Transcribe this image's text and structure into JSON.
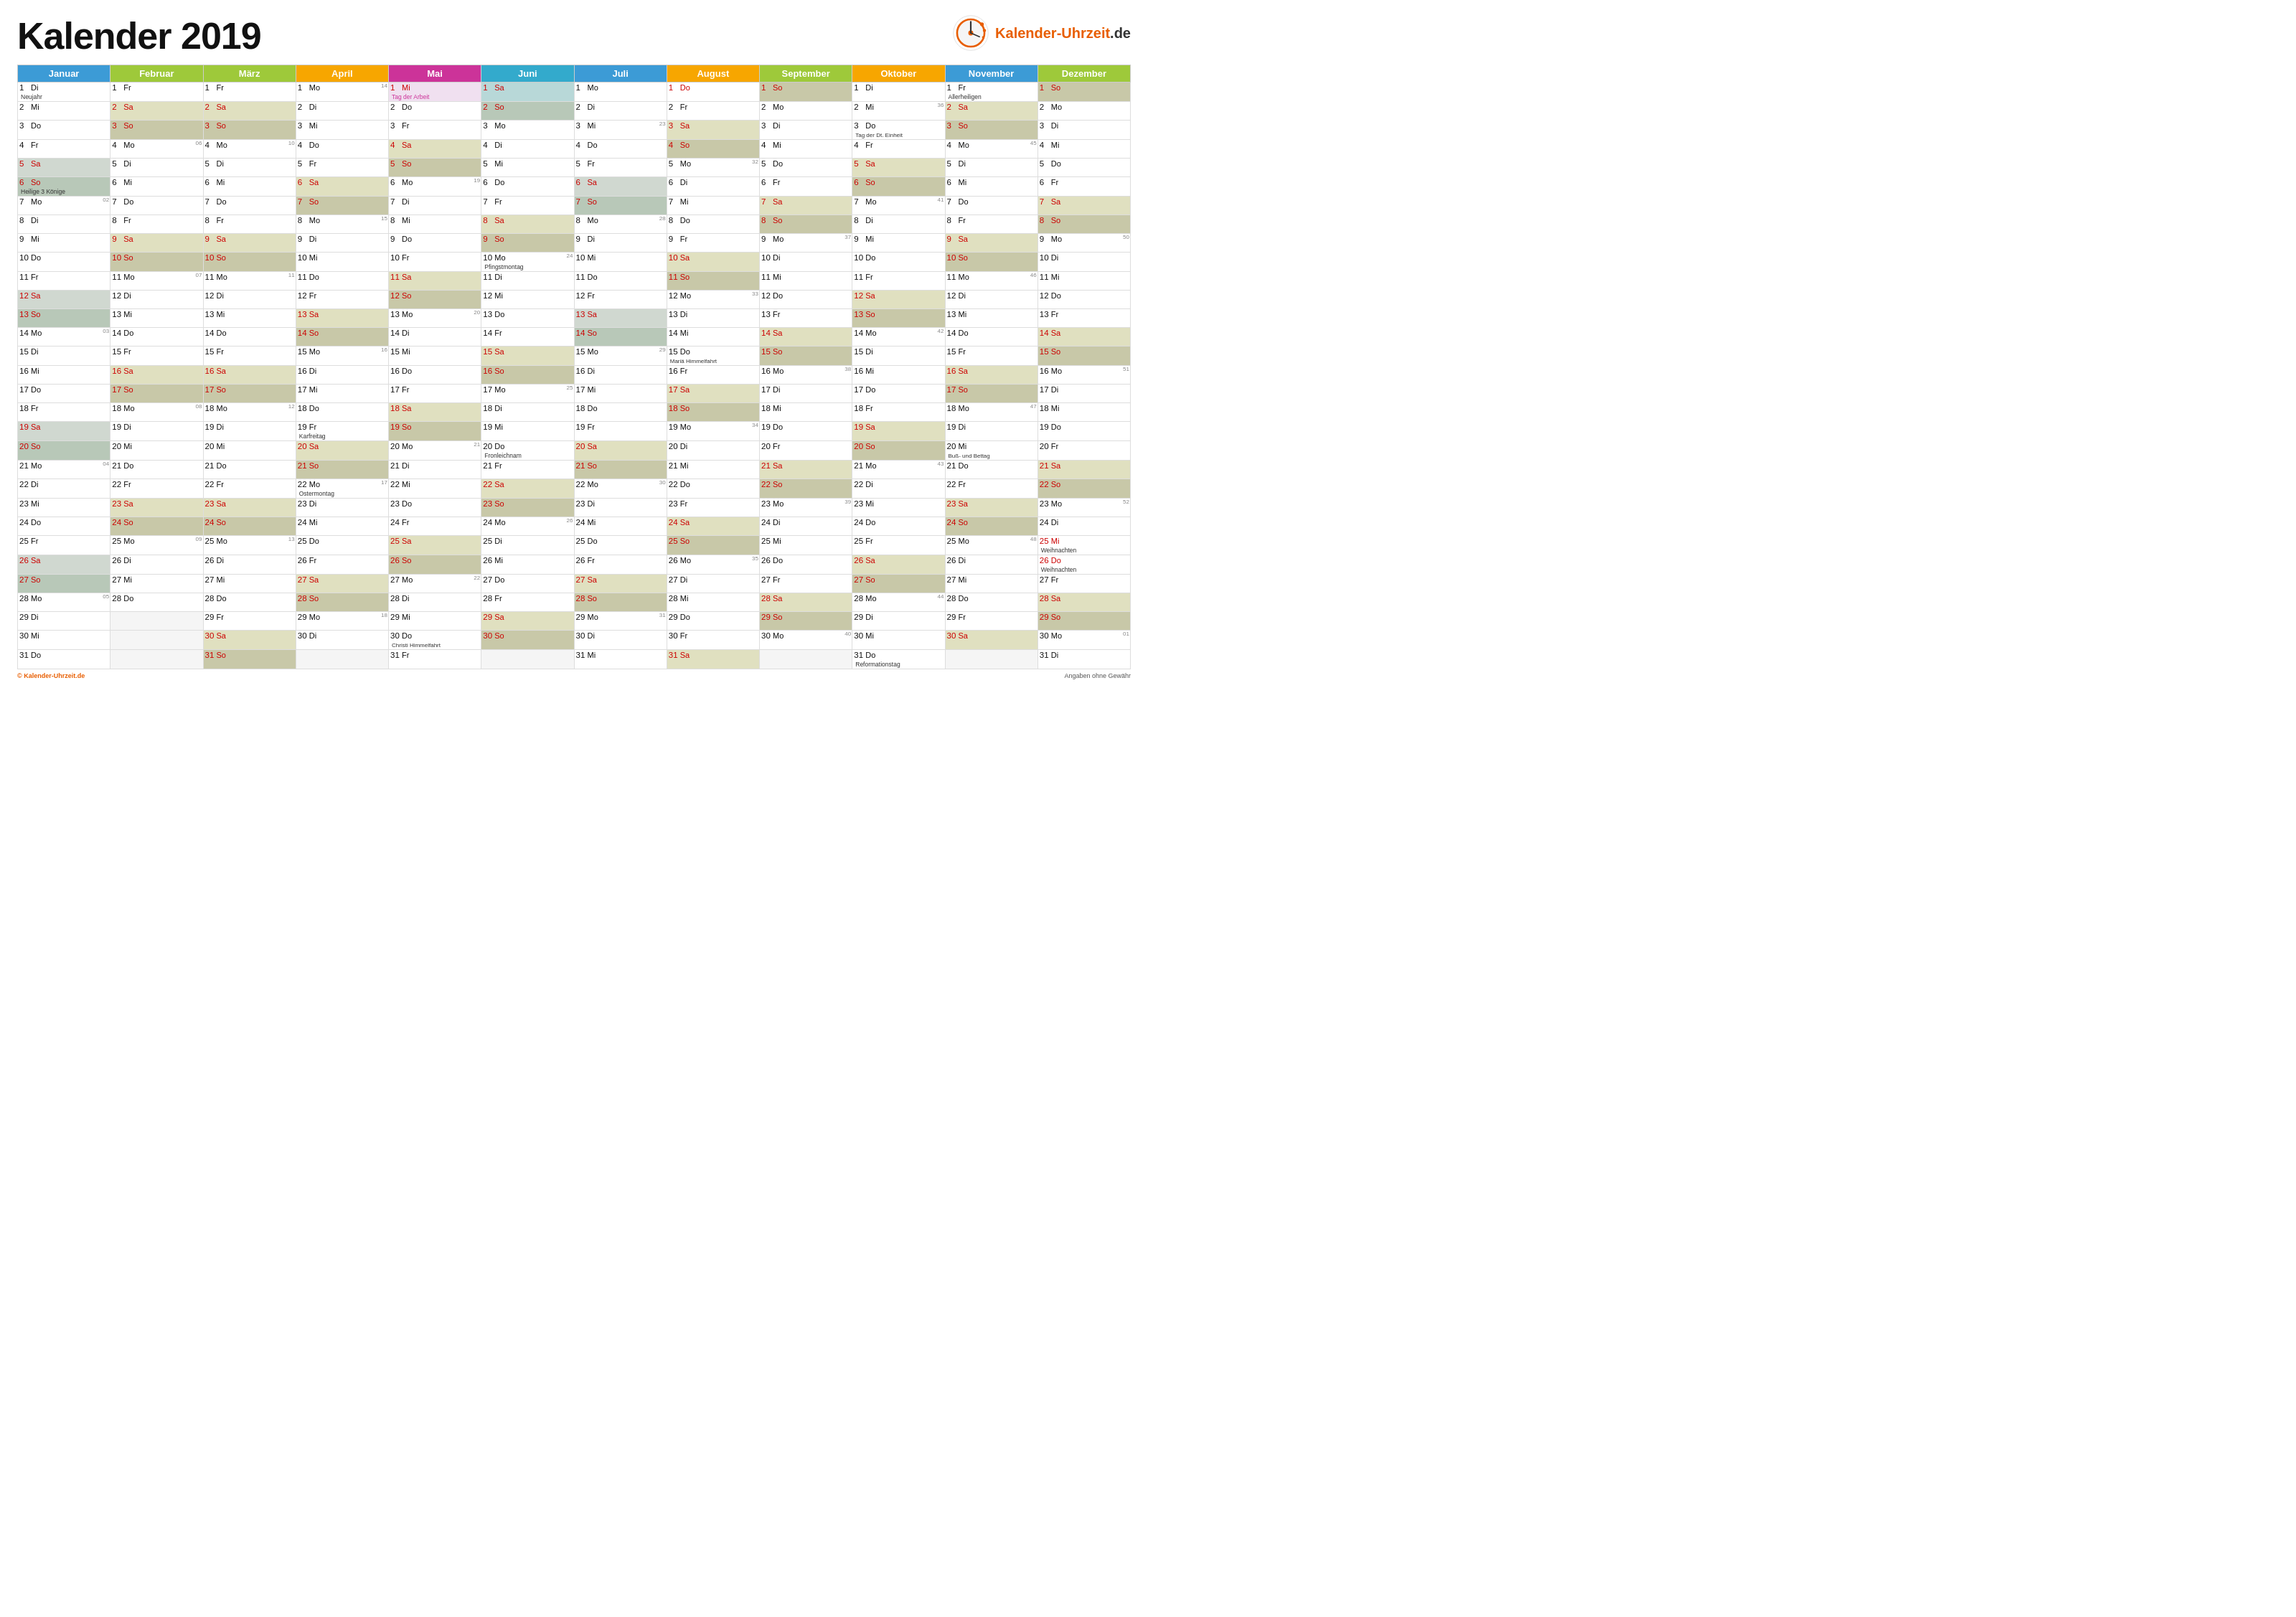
{
  "title": "Kalender 2019",
  "logo": {
    "text1": "Kalender-Uhrzeit",
    "text2": ".de"
  },
  "footer": {
    "site": "© Kalender-Uhrzeit.de",
    "disclaimer": "Angaben ohne Gewähr"
  },
  "months": [
    {
      "name": "Januar",
      "short": "Jan"
    },
    {
      "name": "Februar",
      "short": "Feb"
    },
    {
      "name": "März",
      "short": "Mär"
    },
    {
      "name": "April",
      "short": "Apr"
    },
    {
      "name": "Mai",
      "short": "Mai"
    },
    {
      "name": "Juni",
      "short": "Jun"
    },
    {
      "name": "Juli",
      "short": "Jul"
    },
    {
      "name": "August",
      "short": "Aug"
    },
    {
      "name": "September",
      "short": "Sep"
    },
    {
      "name": "Oktober",
      "short": "Okt"
    },
    {
      "name": "November",
      "short": "Nov"
    },
    {
      "name": "Dezember",
      "short": "Dez"
    }
  ]
}
